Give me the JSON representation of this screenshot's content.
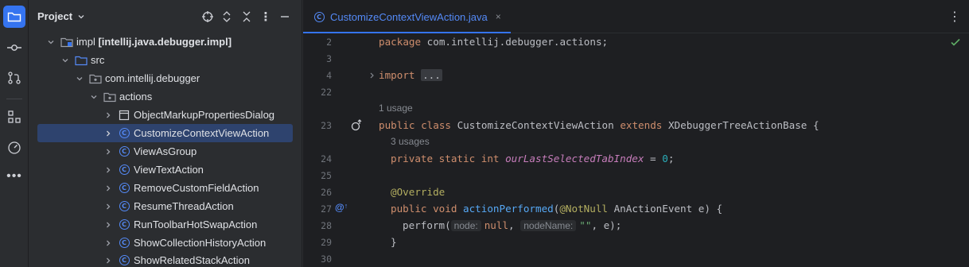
{
  "project_panel": {
    "title": "Project",
    "tree": [
      {
        "label": "impl",
        "module": "[intellij.java.debugger.impl]",
        "kind": "module",
        "depth": 0,
        "expanded": true
      },
      {
        "label": "src",
        "kind": "source-folder",
        "depth": 1,
        "expanded": true
      },
      {
        "label": "com.intellij.debugger",
        "kind": "package",
        "depth": 2,
        "expanded": true
      },
      {
        "label": "actions",
        "kind": "package",
        "depth": 3,
        "expanded": true
      },
      {
        "label": "ObjectMarkupPropertiesDialog",
        "kind": "form",
        "depth": 4,
        "expanded": false
      },
      {
        "label": "CustomizeContextViewAction",
        "kind": "class",
        "depth": 4,
        "expanded": false,
        "selected": true
      },
      {
        "label": "ViewAsGroup",
        "kind": "class",
        "depth": 4,
        "expanded": false
      },
      {
        "label": "ViewTextAction",
        "kind": "class",
        "depth": 4,
        "expanded": false
      },
      {
        "label": "RemoveCustomFieldAction",
        "kind": "class",
        "depth": 4,
        "expanded": false
      },
      {
        "label": "ResumeThreadAction",
        "kind": "class",
        "depth": 4,
        "expanded": false
      },
      {
        "label": "RunToolbarHotSwapAction",
        "kind": "class",
        "depth": 4,
        "expanded": false
      },
      {
        "label": "ShowCollectionHistoryAction",
        "kind": "class",
        "depth": 4,
        "expanded": false
      },
      {
        "label": "ShowRelatedStackAction",
        "kind": "class",
        "depth": 4,
        "expanded": false
      }
    ]
  },
  "editor": {
    "tab": {
      "label": "CustomizeContextViewAction.java",
      "close": "×"
    },
    "lines": {
      "l2": {
        "num": "2",
        "kw": "package",
        "rest": " com.intellij.debugger.actions;"
      },
      "l3": {
        "num": "3"
      },
      "l4": {
        "num": "4",
        "kw": "import",
        "folded": "..."
      },
      "l22": {
        "num": "22"
      },
      "usage1": "1 usage",
      "l23": {
        "num": "23",
        "kw1": "public class",
        "name": " CustomizeContextViewAction ",
        "kw2": "extends",
        "rest": " XDebuggerTreeActionBase {"
      },
      "usage2": "3 usages",
      "l24": {
        "num": "24",
        "kw": "private static int",
        "field": "ourLastSelectedTabIndex",
        "eq": " = ",
        "val": "0",
        "end": ";"
      },
      "l25": {
        "num": "25"
      },
      "l26": {
        "num": "26",
        "ann": "@Override"
      },
      "l27": {
        "num": "27",
        "kw": "public void",
        "fn": "actionPerformed",
        "p1": "(",
        "ann": "@NotNull",
        "rest": " AnActionEvent e) {"
      },
      "l28": {
        "num": "28",
        "call": "perform(",
        "hint1": "node:",
        "arg1": "null",
        "comma": ", ",
        "hint2": "nodeName:",
        "arg2": "\"\"",
        "end": ", e);"
      },
      "l29": {
        "num": "29",
        "text": "}"
      },
      "l30": {
        "num": "30"
      }
    }
  },
  "colors": {
    "accent": "#3574f0",
    "selection": "#2e436e",
    "keyword": "#cf8e6d",
    "function": "#56a8f5",
    "field": "#c77dbb",
    "number": "#2aacb8",
    "string": "#6aab73",
    "annotation": "#b3ae60"
  }
}
